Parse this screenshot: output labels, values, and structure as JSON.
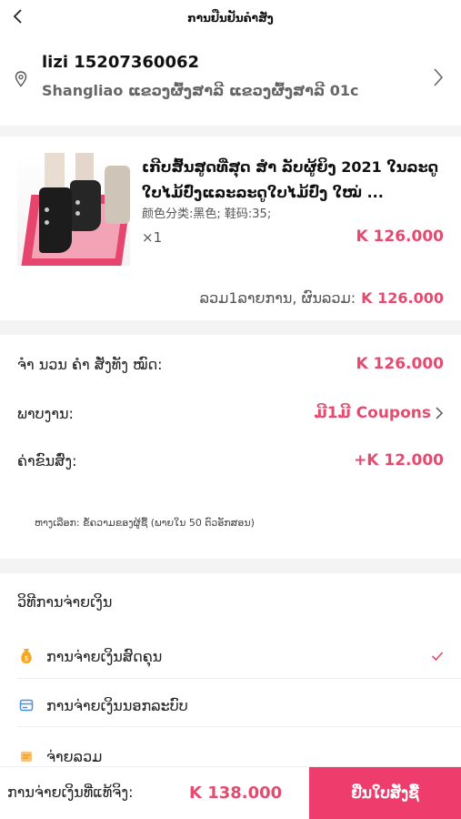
{
  "header": {
    "title": "ການຢືນຢັນຄຳສັ່ງ"
  },
  "address": {
    "name_phone": "lizi 15207360062",
    "detail": "Shangliao ແຂວງຜົ້ງສາລີ ແຂວງຜົ້ງສາລີ 01c"
  },
  "product": {
    "title": "ເກີບສົ້ນສູດທີ່ສຸດ ສຳ ລັບຜູ້ຍິງ 2021 ໃນລະດູໃບໄມ້ປົ່ງແລະລະດູໃບໄມ້ປົ່ງ ໃໝ່ ...",
    "variant": "颜色分类:黑色; 鞋码:35;",
    "quantity": "×1",
    "price": "K 126.000",
    "subtotal_label": "ລວມ1ລາຍການ,  ຜົນລວມ:",
    "subtotal_amount": "K 126.000"
  },
  "summary": {
    "goods_total_label": "ຈຳ ນວນ ຄຳ ສັ່ງທັງ ໝົດ:",
    "goods_total_value": "K 126.000",
    "discount_label": "ພາບງານ:",
    "discount_value": "ມີ1ມີ Coupons",
    "shipping_label": "ຄ່າຂົນສົ່ງ:",
    "shipping_value": "+K 12.000",
    "note": "ຫາງເລືອກ: ຂໍ້ຄວາມຂອງຜູ້ຊື້ (ພາຍໃນ 50 ຕົວອັກສອນ)"
  },
  "payment": {
    "title": "ວິທີການຈ່າຍເງິນ",
    "methods": [
      {
        "label": "ການຈ່າຍເງິນສົດຄຸນ",
        "icon": "money-bag-icon",
        "color": "#f5a623",
        "selected": true
      },
      {
        "label": "ການຈ່າຍເງິນນອກລະບົບ",
        "icon": "card-icon",
        "color": "#4a90e2",
        "selected": false
      },
      {
        "label": "ຈ່າຍລວມ",
        "icon": "wallet-icon",
        "color": "#f5a623",
        "selected": false
      }
    ]
  },
  "footer": {
    "total_label": "ການຈ່າຍເງິນທີ່ແທ້ຈິງ:",
    "total_value": "K 138.000",
    "submit_label": "ຢືນໃບສັ່ງຊື້"
  },
  "colors": {
    "accent": "#e64a6e",
    "submit": "#ee3d6c"
  }
}
